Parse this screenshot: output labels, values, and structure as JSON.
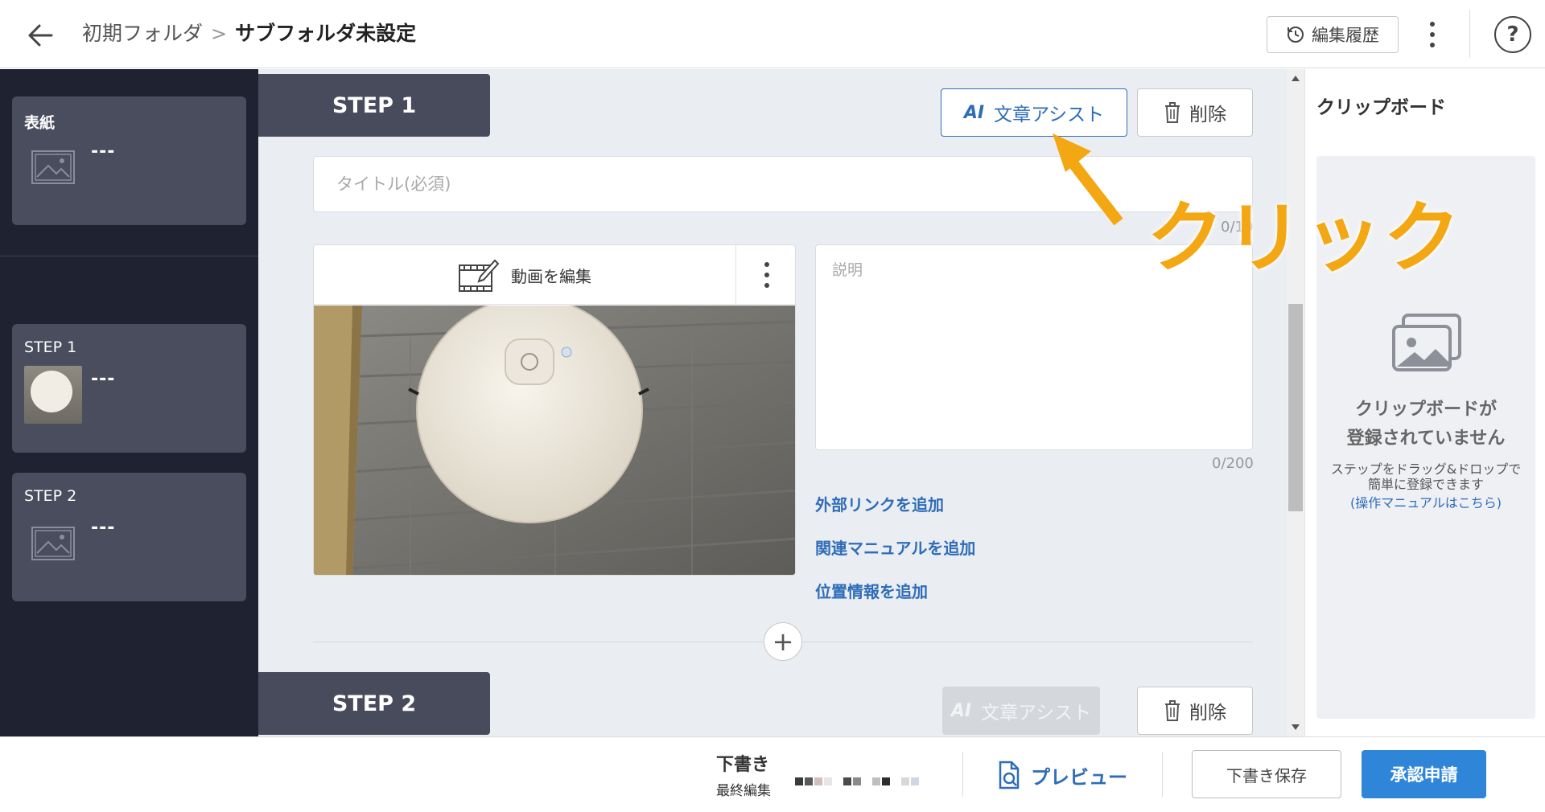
{
  "header": {
    "breadcrumb_parent": "初期フォルダ",
    "breadcrumb_sep": ">",
    "breadcrumb_current": "サブフォルダ未設定",
    "history_label": "編集履歴",
    "help_label": "?"
  },
  "sidebar": {
    "cover": {
      "label": "表紙",
      "title": "---"
    },
    "steps": [
      {
        "label": "STEP 1",
        "title": "---"
      },
      {
        "label": "STEP 2",
        "title": "---"
      }
    ]
  },
  "main": {
    "step1": {
      "tab_label": "STEP 1",
      "ai_prefix": "AI",
      "ai_label": "文章アシスト",
      "delete_label": "削除",
      "title_placeholder": "タイトル(必須)",
      "title_counter": "0/10",
      "edit_video_label": "動画を編集",
      "desc_placeholder": "説明",
      "desc_counter": "0/200",
      "links": [
        "外部リンクを追加",
        "関連マニュアルを追加",
        "位置情報を追加"
      ],
      "add_step_symbol": "+"
    },
    "step2": {
      "tab_label": "STEP 2",
      "ai_prefix": "AI",
      "ai_label": "文章アシスト",
      "delete_label": "削除"
    }
  },
  "clipboard": {
    "title": "クリップボード",
    "empty_line1": "クリップボードが",
    "empty_line2": "登録されていません",
    "hint_line1": "ステップをドラッグ&ドロップで",
    "hint_line2": "簡単に登録できます",
    "hint_link": "(操作マニュアルはこちら)"
  },
  "footer": {
    "status": "下書き",
    "last_edit_label": "最終編集",
    "preview_label": "プレビュー",
    "save_label": "下書き保存",
    "submit_label": "承認申請"
  },
  "annotation": {
    "text": "クリック"
  },
  "colors": {
    "accent": "#2f6db8",
    "primary_button": "#2f86d9",
    "sidebar_bg": "#1f2230",
    "card_bg": "#4a4d5e",
    "annotation": "#f3a712"
  }
}
